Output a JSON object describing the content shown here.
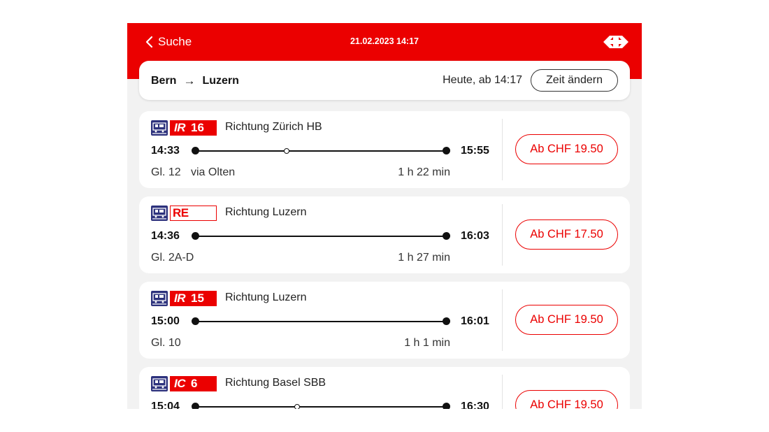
{
  "header": {
    "back_label": "Suche",
    "datetime": "21.02.2023 14:17",
    "brand_color": "#eb0000",
    "logo_icon": "sbb-logo-icon"
  },
  "route": {
    "from": "Bern",
    "arrow": "→",
    "to": "Luzern",
    "when": "Heute, ab 14:17",
    "change_time_label": "Zeit ändern"
  },
  "connections": [
    {
      "product": "IR",
      "line": "16",
      "badge_style": "solid",
      "direction": "Richtung Zürich HB",
      "departure": "14:33",
      "arrival": "15:55",
      "platform": "Gl. 12",
      "via": "via Olten",
      "duration": "1 h 22 min",
      "intermediate_stops": 1,
      "price": "Ab CHF 19.50"
    },
    {
      "product": "RE",
      "line": "",
      "badge_style": "outline",
      "direction": "Richtung Luzern",
      "departure": "14:36",
      "arrival": "16:03",
      "platform": "Gl. 2A-D",
      "via": "",
      "duration": "1 h 27 min",
      "intermediate_stops": 0,
      "price": "Ab CHF 17.50"
    },
    {
      "product": "IR",
      "line": "15",
      "badge_style": "solid",
      "direction": "Richtung Luzern",
      "departure": "15:00",
      "arrival": "16:01",
      "platform": "Gl. 10",
      "via": "",
      "duration": "1 h 1 min",
      "intermediate_stops": 0,
      "price": "Ab CHF 19.50"
    },
    {
      "product": "IC",
      "line": "6",
      "badge_style": "solid",
      "direction": "Richtung Basel SBB",
      "departure": "15:04",
      "arrival": "16:30",
      "platform": "",
      "via": "",
      "duration": "",
      "intermediate_stops": 1,
      "price": "Ab CHF 19.50"
    }
  ]
}
